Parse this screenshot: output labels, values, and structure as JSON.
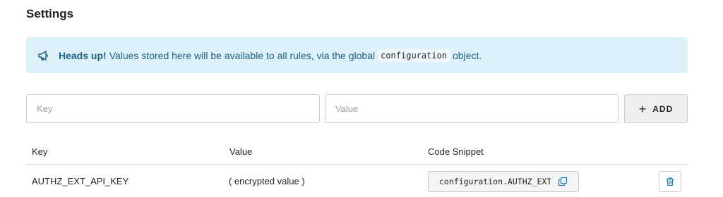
{
  "page": {
    "title": "Settings"
  },
  "alert": {
    "icon": "megaphone-icon",
    "strong": "Heads up!",
    "text_before": "Values stored here will be available to all rules, via the global",
    "code": "configuration",
    "text_after": "object.",
    "background": "#dcf1f9",
    "color": "#1f5f82"
  },
  "form": {
    "key_placeholder": "Key",
    "value_placeholder": "Value",
    "add_icon": "plus-icon",
    "add_label": "ADD"
  },
  "table": {
    "headers": {
      "key": "Key",
      "value": "Value",
      "snippet": "Code Snippet"
    },
    "rows": [
      {
        "key": "AUTHZ_EXT_API_KEY",
        "value": "( encrypted value )",
        "snippet": "configuration.AUTHZ_EXT_API_KEY",
        "copy_icon": "copy-icon",
        "delete_icon": "trash-icon"
      }
    ]
  },
  "colors": {
    "accent": "#1f7ab8",
    "border": "#c9cace"
  }
}
